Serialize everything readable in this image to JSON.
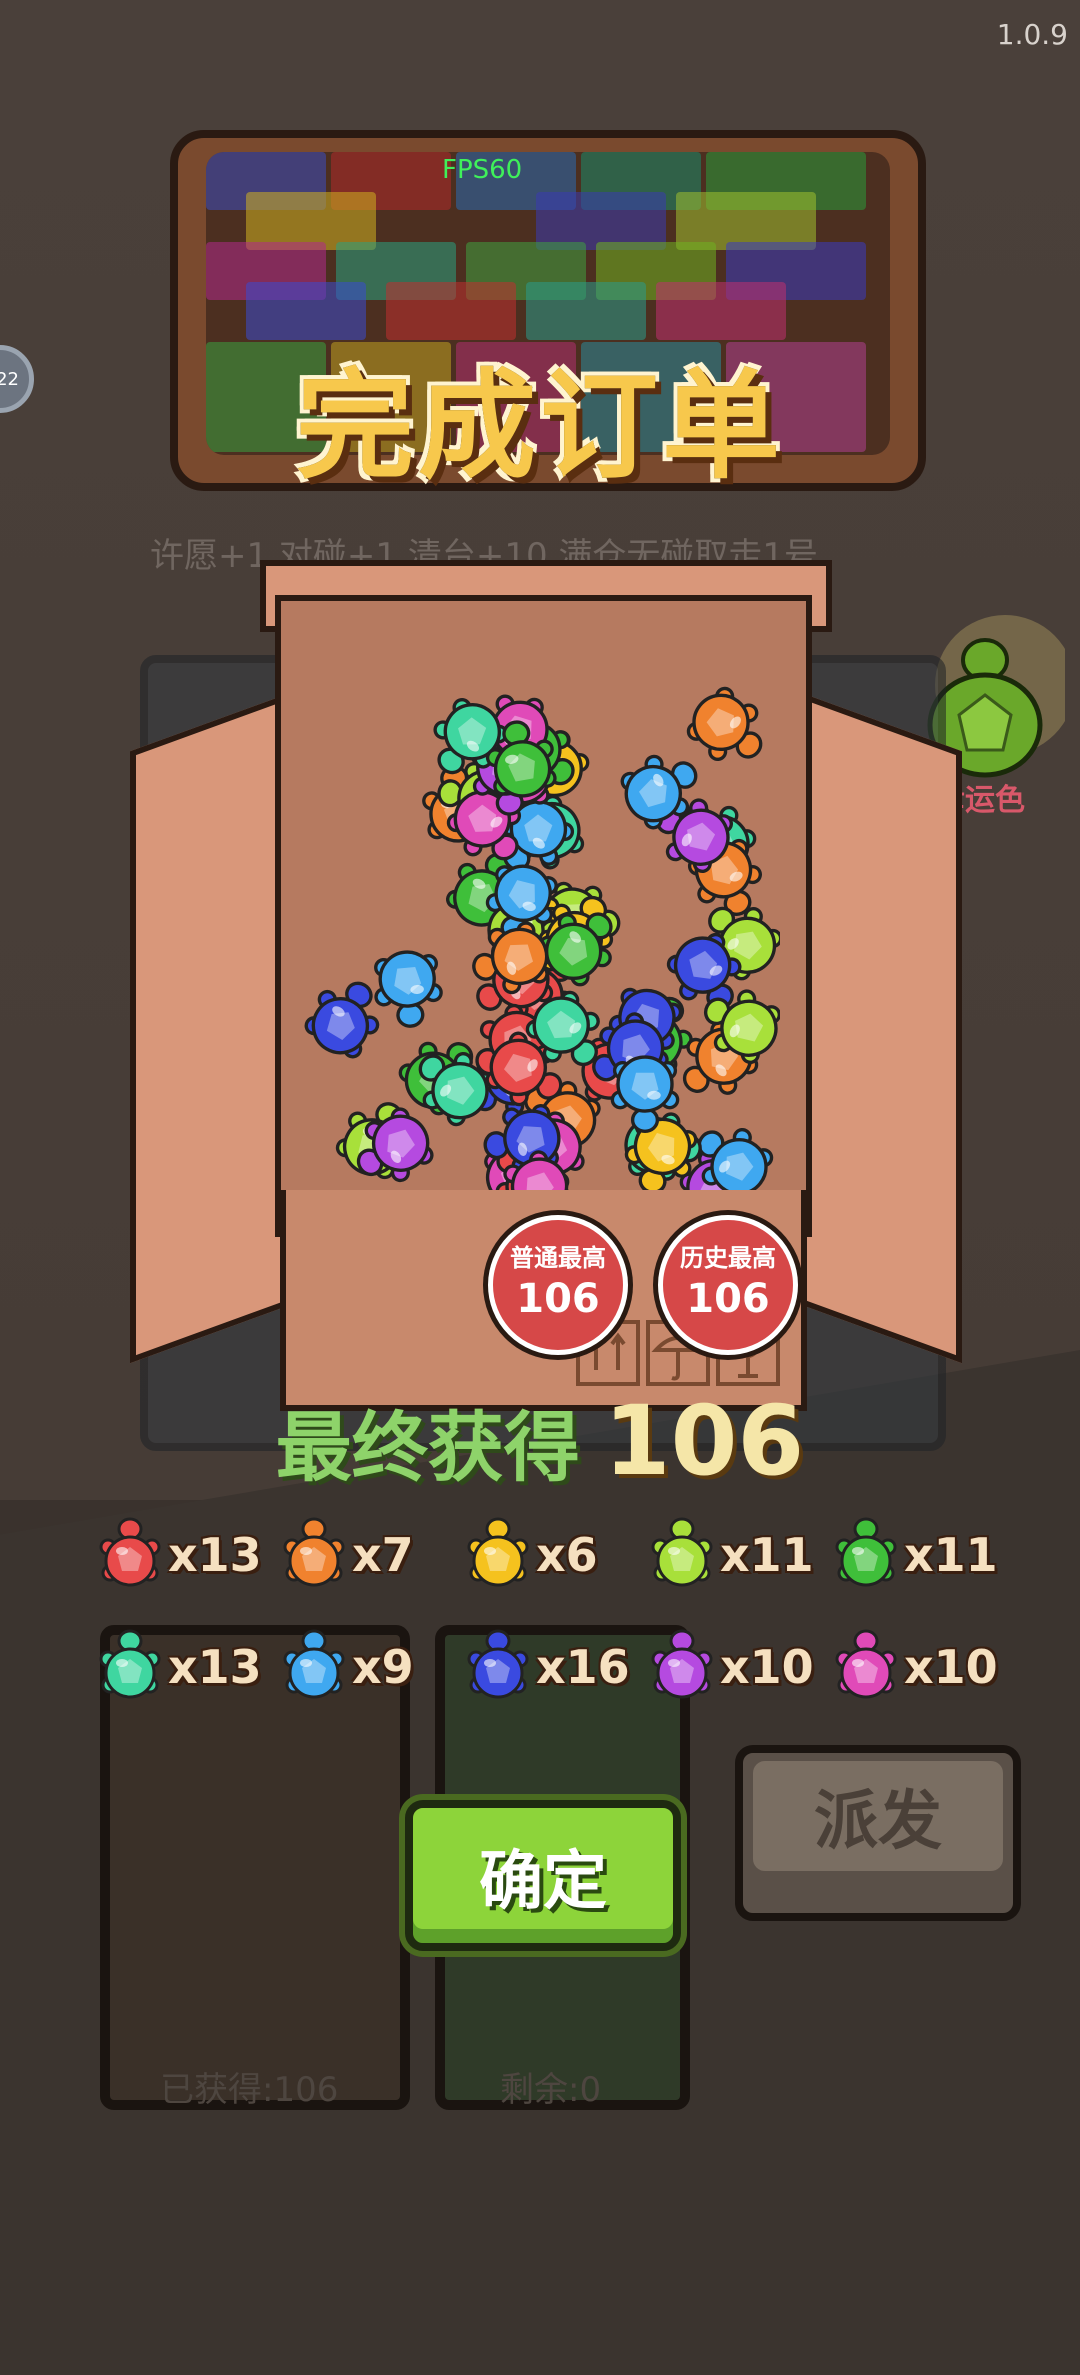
{
  "version": "1.0.9",
  "fps": "FPS60",
  "side_badge": "22",
  "title": "完成订单",
  "description_line": "许愿+1 对碰+1 清台+10 满仓无碰取走1号",
  "lucky_label": "幸运色",
  "stamps": [
    {
      "label": "普通最高",
      "value": "106"
    },
    {
      "label": "历史最高",
      "value": "106"
    }
  ],
  "final": {
    "label": "最终获得",
    "value": "106"
  },
  "counts": [
    {
      "color": "#e84a4a",
      "text": "x13"
    },
    {
      "color": "#f0822e",
      "text": "x7"
    },
    {
      "color": "#f5c21e",
      "text": "x6"
    },
    {
      "color": "#a8e03a",
      "text": "x11"
    },
    {
      "color": "#3fbf3a",
      "text": "x11"
    },
    {
      "color": "#3fd6a0",
      "text": "x13"
    },
    {
      "color": "#3fa8f0",
      "text": "x9"
    },
    {
      "color": "#3a4ae0",
      "text": "x16"
    },
    {
      "color": "#b54ae0",
      "text": "x10"
    },
    {
      "color": "#e04ab8",
      "text": "x10"
    }
  ],
  "obtained_label": "已获得:106",
  "remaining_label": "剩余:0",
  "confirm_label": "确定",
  "dispatch_label": "派发"
}
